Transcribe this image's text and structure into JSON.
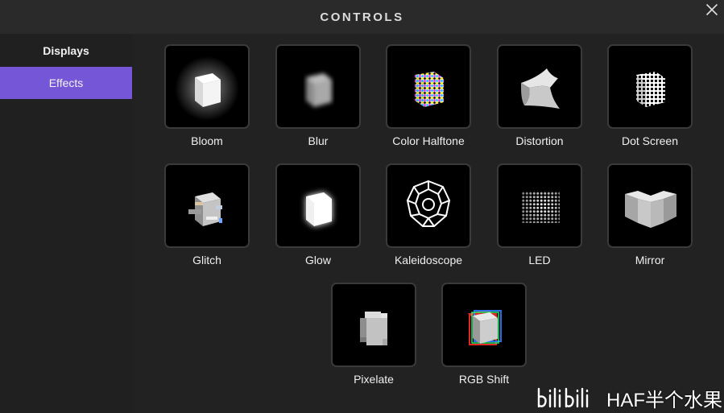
{
  "header": {
    "title": "CONTROLS"
  },
  "sidebar": {
    "items": [
      {
        "label": "Displays",
        "active": false
      },
      {
        "label": "Effects",
        "active": true
      }
    ]
  },
  "effects": [
    {
      "label": "Bloom",
      "icon": "bloom-icon"
    },
    {
      "label": "Blur",
      "icon": "blur-icon"
    },
    {
      "label": "Color Halftone",
      "icon": "color-halftone-icon"
    },
    {
      "label": "Distortion",
      "icon": "distortion-icon"
    },
    {
      "label": "Dot Screen",
      "icon": "dot-screen-icon"
    },
    {
      "label": "Glitch",
      "icon": "glitch-icon"
    },
    {
      "label": "Glow",
      "icon": "glow-icon"
    },
    {
      "label": "Kaleidoscope",
      "icon": "kaleidoscope-icon"
    },
    {
      "label": "LED",
      "icon": "led-icon"
    },
    {
      "label": "Mirror",
      "icon": "mirror-icon"
    },
    {
      "label": "Pixelate",
      "icon": "pixelate-icon"
    },
    {
      "label": "RGB Shift",
      "icon": "rgb-shift-icon"
    }
  ],
  "watermark": {
    "text": "HAF半个水果",
    "logo": "bilibili"
  },
  "colors": {
    "accent": "#7556d6",
    "background": "#222222",
    "header": "#2a2a2a"
  }
}
